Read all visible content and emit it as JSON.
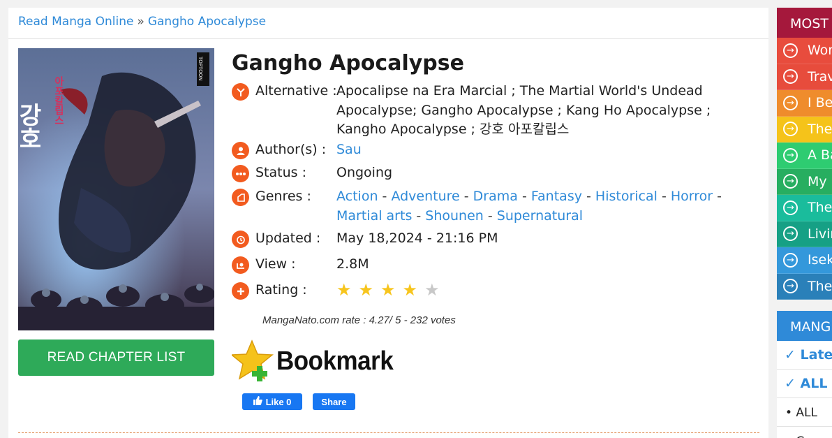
{
  "breadcrumb": {
    "home": "Read Manga Online",
    "separator": "»",
    "current": "Gangho Apocalypse"
  },
  "manga": {
    "title": "Gangho Apocalypse",
    "read_button": "READ CHAPTER LIST",
    "alternative_label": "Alternative :",
    "alternative_value": "Apocalipse na Era Marcial ; The Martial World's Undead Apocalypse; Gangho Apocalypse ; Kang Ho Apocalypse ; Kangho Apocalypse ; 강호 아포칼립스",
    "author_label": "Author(s) :",
    "author": "Sau",
    "status_label": "Status :",
    "status": "Ongoing",
    "genres_label": "Genres :",
    "genres": [
      "Action",
      "Adventure",
      "Drama",
      "Fantasy",
      "Historical",
      "Horror",
      "Martial arts",
      "Shounen",
      "Supernatural"
    ],
    "genre_separator": "-",
    "updated_label": "Updated :",
    "updated": "May 18,2024 - 21:16 PM",
    "view_label": "View :",
    "views": "2.8M",
    "rating_label": "Rating :",
    "rating_stars": 4,
    "rating_max": 5,
    "rate_text": "MangaNato.com rate : 4.27/ 5 - 232 votes",
    "bookmark_label": "Bookmark",
    "fb_like": "Like 0",
    "fb_share": "Share"
  },
  "cover": {
    "title_text": "강호",
    "subtitle_text": "아포칼립스",
    "publisher_text": "TOPTOON"
  },
  "sidebar": {
    "most_popular_title": "MOST",
    "popular": [
      {
        "label": "Wor",
        "color": "#e84c3d"
      },
      {
        "label": "Trav",
        "color": "#e74c3c"
      },
      {
        "label": "I Be",
        "color": "#ef8c2c"
      },
      {
        "label": "The",
        "color": "#f5c31a"
      },
      {
        "label": "A Ba",
        "color": "#2ecc71"
      },
      {
        "label": "My I",
        "color": "#27ae60"
      },
      {
        "label": "The",
        "color": "#1abc9c"
      },
      {
        "label": "Livin",
        "color": "#16a085"
      },
      {
        "label": "Isek",
        "color": "#3498db"
      },
      {
        "label": "The",
        "color": "#2a80b9"
      }
    ],
    "manga_list_title": "MANG",
    "links": [
      "✓ Lates",
      "✓ ALL"
    ],
    "plain": [
      "• ALL",
      "• Come"
    ]
  },
  "colors": {
    "accent": "#2f8ad8",
    "icon_orange": "#f25b1f",
    "read_button": "#2eaa59",
    "sidebar_head": "#a5183c",
    "facebook": "#1877f2"
  }
}
